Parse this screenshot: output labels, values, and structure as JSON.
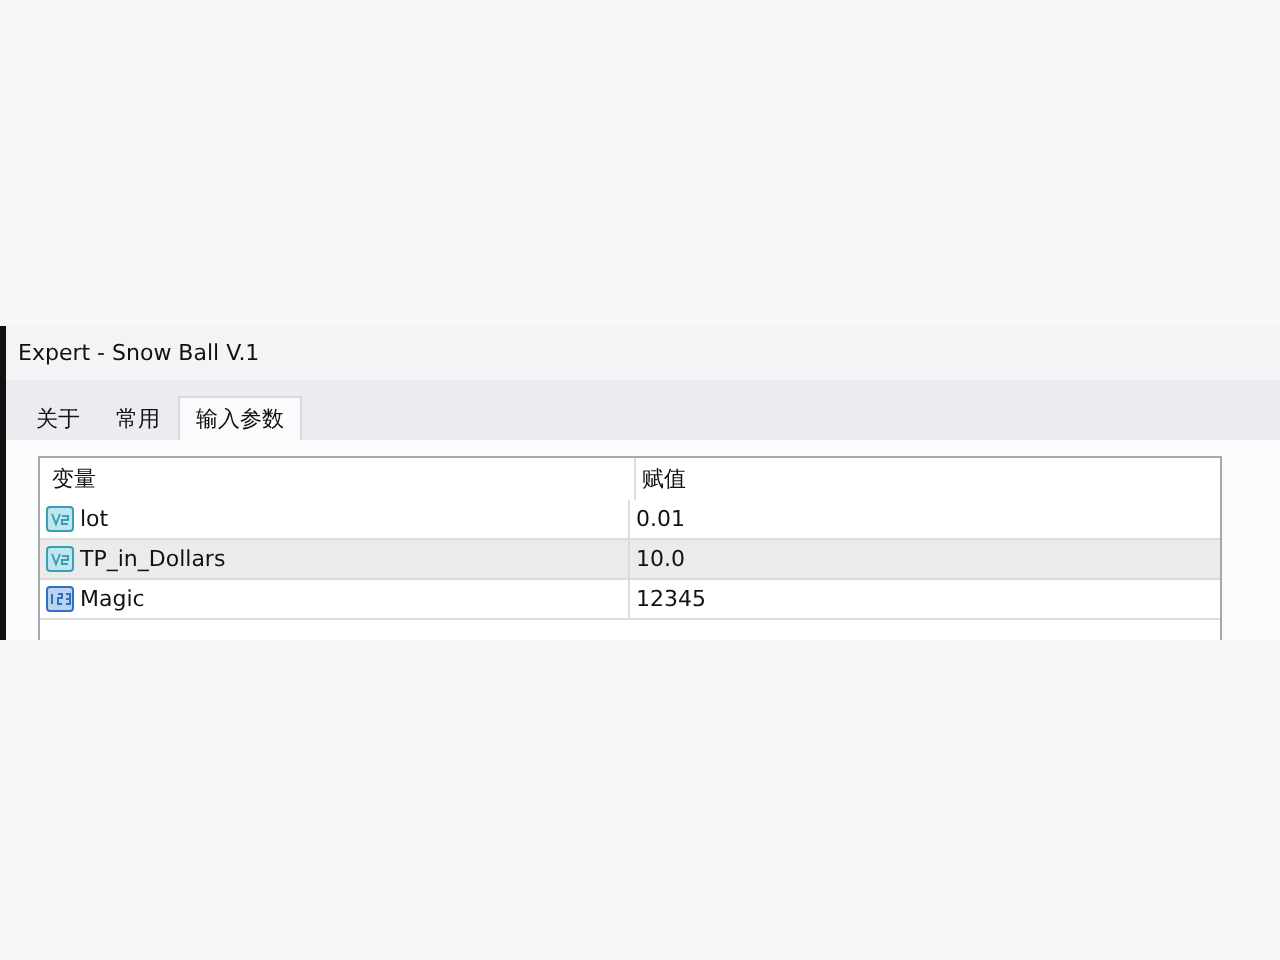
{
  "window": {
    "title": "Expert - Snow Ball V.1"
  },
  "tabs": [
    {
      "label": "关于",
      "selected": false
    },
    {
      "label": "常用",
      "selected": false
    },
    {
      "label": "输入参数",
      "selected": true
    }
  ],
  "table": {
    "columns": [
      "变量",
      "赋值"
    ],
    "rows": [
      {
        "kind": "double",
        "name": "lot",
        "value": "0.01",
        "selected": false
      },
      {
        "kind": "double",
        "name": "TP_in_Dollars",
        "value": "10.0",
        "selected": true
      },
      {
        "kind": "int",
        "name": "Magic",
        "value": "12345",
        "selected": false
      }
    ]
  }
}
